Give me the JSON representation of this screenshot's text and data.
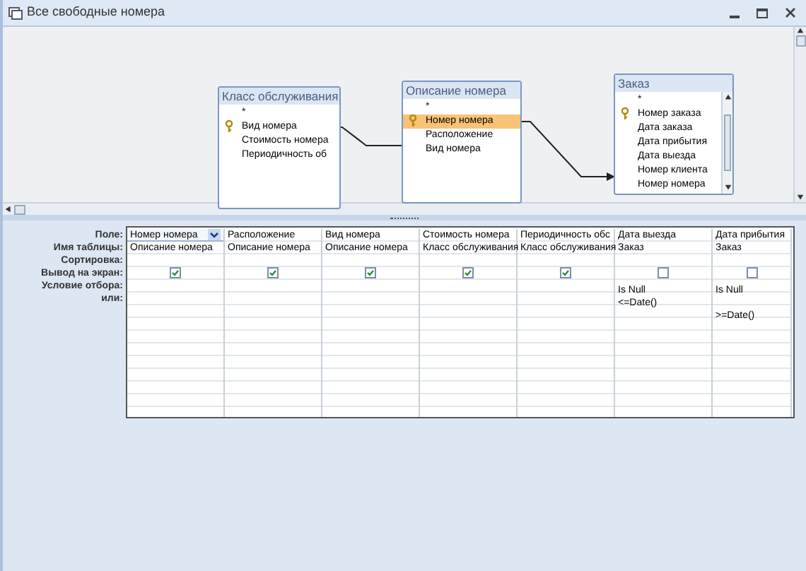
{
  "window": {
    "title": "Все свободные номера"
  },
  "tables": [
    {
      "title": "Класс обслуживания",
      "scrollbar": false,
      "fields": [
        {
          "name": "*",
          "key": false,
          "selected": false
        },
        {
          "name": "Вид номера",
          "key": true,
          "selected": false
        },
        {
          "name": "Стоимость номера",
          "key": false,
          "selected": false
        },
        {
          "name": "Периодичность об",
          "key": false,
          "selected": false
        }
      ]
    },
    {
      "title": "Описание номера",
      "scrollbar": false,
      "fields": [
        {
          "name": "*",
          "key": false,
          "selected": false
        },
        {
          "name": "Номер номера",
          "key": true,
          "selected": true
        },
        {
          "name": "Расположение",
          "key": false,
          "selected": false
        },
        {
          "name": "Вид номера",
          "key": false,
          "selected": false
        }
      ]
    },
    {
      "title": "Заказ",
      "scrollbar": true,
      "fields": [
        {
          "name": "*",
          "key": false,
          "selected": false
        },
        {
          "name": "Номер заказа",
          "key": true,
          "selected": false
        },
        {
          "name": "Дата заказа",
          "key": false,
          "selected": false
        },
        {
          "name": "Дата прибытия",
          "key": false,
          "selected": false
        },
        {
          "name": "Дата выезда",
          "key": false,
          "selected": false
        },
        {
          "name": "Номер клиента",
          "key": false,
          "selected": false
        },
        {
          "name": "Номер номера",
          "key": false,
          "selected": false
        }
      ]
    }
  ],
  "row_labels": [
    "Поле:",
    "Имя таблицы:",
    "Сортировка:",
    "Вывод на экран:",
    "Условие отбора:",
    "или:"
  ],
  "columns": [
    {
      "field": "Номер номера",
      "table": "Описание номера",
      "show": true,
      "selected": true
    },
    {
      "field": "Расположение",
      "table": "Описание номера",
      "show": true,
      "selected": false
    },
    {
      "field": "Вид номера",
      "table": "Описание номера",
      "show": true,
      "selected": false
    },
    {
      "field": "Стоимость номера",
      "table": "Класс обслуживания",
      "show": true,
      "selected": false
    },
    {
      "field": "Периодичность обс",
      "table": "Класс обслуживания",
      "show": true,
      "selected": false
    },
    {
      "field": "Дата выезда",
      "table": "Заказ",
      "show": false,
      "selected": false,
      "condition": "Is Null",
      "or": "<=Date()"
    },
    {
      "field": "Дата прибытия",
      "table": "Заказ",
      "show": false,
      "selected": false,
      "condition": "Is Null",
      "or_2": ">=Date()"
    }
  ]
}
